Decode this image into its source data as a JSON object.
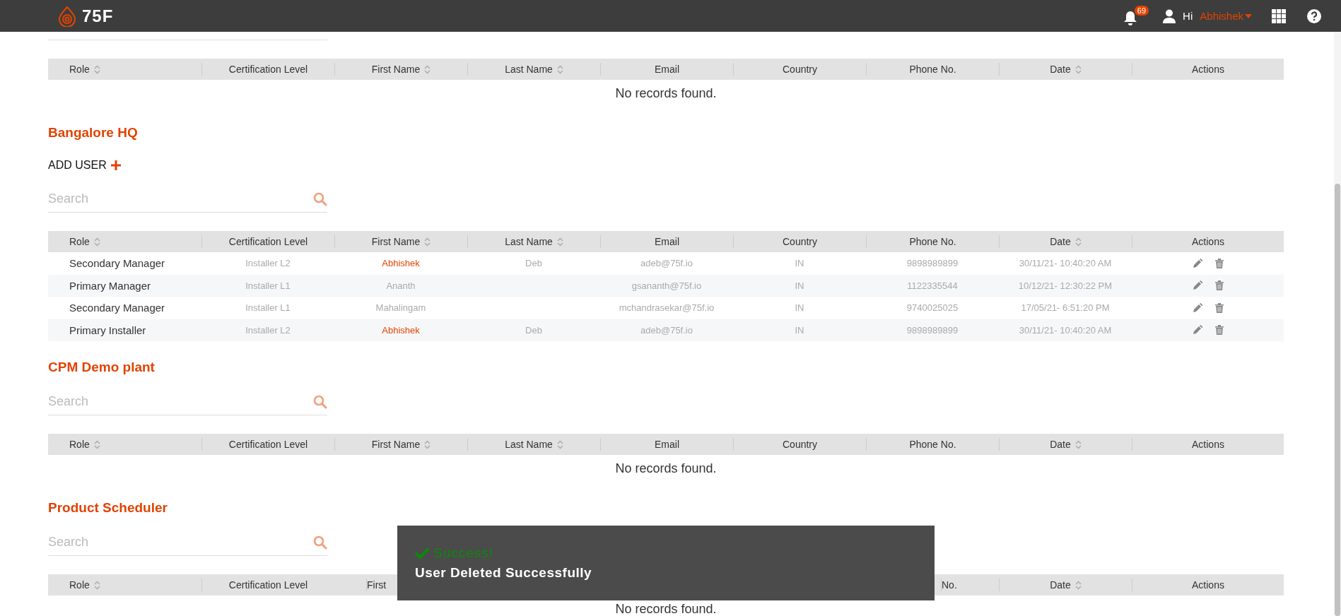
{
  "header": {
    "logo_text": "75F",
    "notification_count": "69",
    "greeting": "Hi",
    "user_name": "Abhishek"
  },
  "sections": [
    {
      "columns": [
        {
          "label": "Role",
          "sortable": true
        },
        {
          "label": "Certification Level",
          "sortable": false
        },
        {
          "label": "First Name",
          "sortable": true
        },
        {
          "label": "Last Name",
          "sortable": true
        },
        {
          "label": "Email",
          "sortable": false
        },
        {
          "label": "Country",
          "sortable": false
        },
        {
          "label": "Phone No.",
          "sortable": false
        },
        {
          "label": "Date",
          "sortable": true
        },
        {
          "label": "Actions",
          "sortable": false
        }
      ],
      "empty_message": "No records found."
    },
    {
      "title": "Bangalore HQ",
      "add_user": "ADD USER",
      "search": {
        "placeholder": "Search"
      },
      "columns": [
        {
          "label": "Role",
          "sortable": true
        },
        {
          "label": "Certification Level",
          "sortable": false
        },
        {
          "label": "First Name",
          "sortable": true
        },
        {
          "label": "Last Name",
          "sortable": true
        },
        {
          "label": "Email",
          "sortable": false
        },
        {
          "label": "Country",
          "sortable": false
        },
        {
          "label": "Phone No.",
          "sortable": false
        },
        {
          "label": "Date",
          "sortable": true
        },
        {
          "label": "Actions",
          "sortable": false
        }
      ],
      "rows": [
        {
          "role": "Secondary Manager",
          "certification": "Installer L2",
          "first_name": "Abhishek",
          "first_name_highlighted": true,
          "last_name": "Deb",
          "email": "adeb@75f.io",
          "country": "IN",
          "phone": "9898989899",
          "date": "30/11/21- 10:40:20 AM"
        },
        {
          "role": "Primary Manager",
          "certification": "Installer L1",
          "first_name": "Ananth",
          "first_name_highlighted": false,
          "last_name": "",
          "email": "gsananth@75f.io",
          "country": "IN",
          "phone": "1122335544",
          "date": "10/12/21- 12:30:22 PM"
        },
        {
          "role": "Secondary Manager",
          "certification": "Installer L1",
          "first_name": "Mahalingam",
          "first_name_highlighted": false,
          "last_name": "",
          "email": "mchandrasekar@75f.io",
          "country": "IN",
          "phone": "9740025025",
          "date": "17/05/21- 6:51:20 PM"
        },
        {
          "role": "Primary Installer",
          "certification": "Installer L2",
          "first_name": "Abhishek",
          "first_name_highlighted": true,
          "last_name": "Deb",
          "email": "adeb@75f.io",
          "country": "IN",
          "phone": "9898989899",
          "date": "30/11/21- 10:40:20 AM"
        }
      ]
    },
    {
      "title": "CPM Demo plant",
      "search": {
        "placeholder": "Search"
      },
      "columns": [
        {
          "label": "Role",
          "sortable": true
        },
        {
          "label": "Certification Level",
          "sortable": false
        },
        {
          "label": "First Name",
          "sortable": true
        },
        {
          "label": "Last Name",
          "sortable": true
        },
        {
          "label": "Email",
          "sortable": false
        },
        {
          "label": "Country",
          "sortable": false
        },
        {
          "label": "Phone No.",
          "sortable": false
        },
        {
          "label": "Date",
          "sortable": true
        },
        {
          "label": "Actions",
          "sortable": false
        }
      ],
      "empty_message": "No records found."
    },
    {
      "title": "Product Scheduler",
      "search": {
        "placeholder": "Search"
      },
      "columns": [
        {
          "label": "Role",
          "sortable": true
        },
        {
          "label": "Certification Level",
          "sortable": false
        },
        {
          "label": "First"
        },
        {},
        {},
        {},
        {
          "label": "No."
        },
        {
          "label": "Date",
          "sortable": true
        },
        {
          "label": "Actions",
          "sortable": false
        }
      ],
      "empty_message": "No records found."
    }
  ],
  "toast": {
    "title": "Success!",
    "message": "User Deleted Successfully"
  }
}
